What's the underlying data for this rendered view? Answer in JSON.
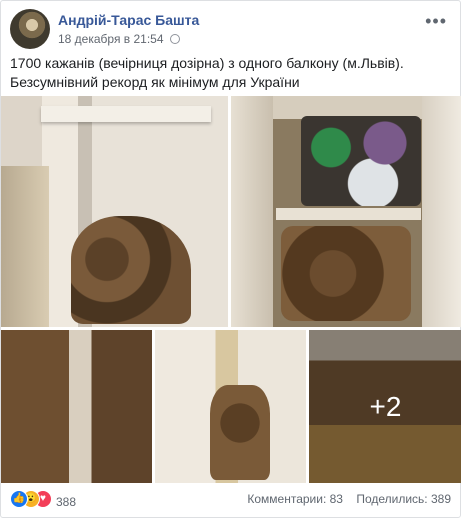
{
  "post": {
    "author": "Андрій-Тарас Башта",
    "timestamp": "18 декабря в 21:54",
    "text": "1700 кажанів (вечірниця дозірна) з одного балкону (м.Львів). Безсумнівний рекорд як мінімум для України",
    "more_photos_label": "+2"
  },
  "reactions": {
    "icons": [
      "like-icon",
      "wow-icon",
      "love-icon"
    ],
    "count": "388"
  },
  "engagement": {
    "comments": "Комментарии: 83",
    "shares": "Поделились: 389"
  },
  "colors": {
    "author_link": "#385898",
    "meta_text": "#616770",
    "like": "#1877f2",
    "wow": "#f7b125",
    "love": "#f33e58"
  }
}
